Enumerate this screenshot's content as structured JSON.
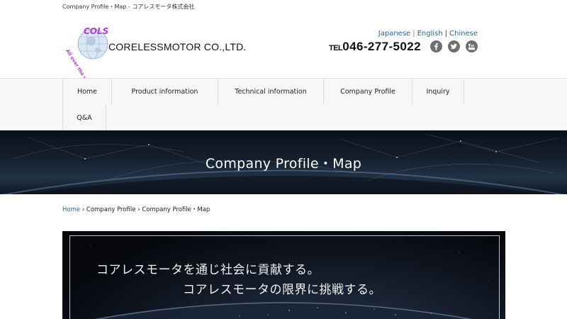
{
  "topbar": {
    "text": "Company Profile・Map - コアレスモータ株式会社"
  },
  "header": {
    "logo_text": "COLS",
    "logo_tagline": "All over the world",
    "company_name": "CORELESSMOTOR CO.,LTD.",
    "languages": [
      {
        "label": "Japanese"
      },
      {
        "label": "English"
      },
      {
        "label": "Chinese"
      }
    ],
    "tel_label": "TEL",
    "tel_number": "046-277-5022",
    "social": [
      {
        "icon": "facebook-icon"
      },
      {
        "icon": "twitter-icon"
      },
      {
        "icon": "youtube-icon"
      }
    ]
  },
  "nav": {
    "items": [
      {
        "label": "Home"
      },
      {
        "label": "Product information"
      },
      {
        "label": "Technical information"
      },
      {
        "label": "Company Profile"
      },
      {
        "label": "Inquiry"
      },
      {
        "label": "Q&A"
      }
    ]
  },
  "hero": {
    "title": "Company Profile・Map"
  },
  "breadcrumb": {
    "home": "Home",
    "sep": "›",
    "parent": "Company Profile",
    "current": "Company Profile・Map"
  },
  "banner": {
    "line1": "コアレスモータを通じ社会に貢献する。",
    "line2": "コアレスモータの限界に挑戦する。"
  },
  "colors": {
    "link": "#2a5db0",
    "logo_purple": "#b23bd8",
    "nav_bg": "#f7f7f7",
    "social_gray": "#6f6f6f"
  }
}
